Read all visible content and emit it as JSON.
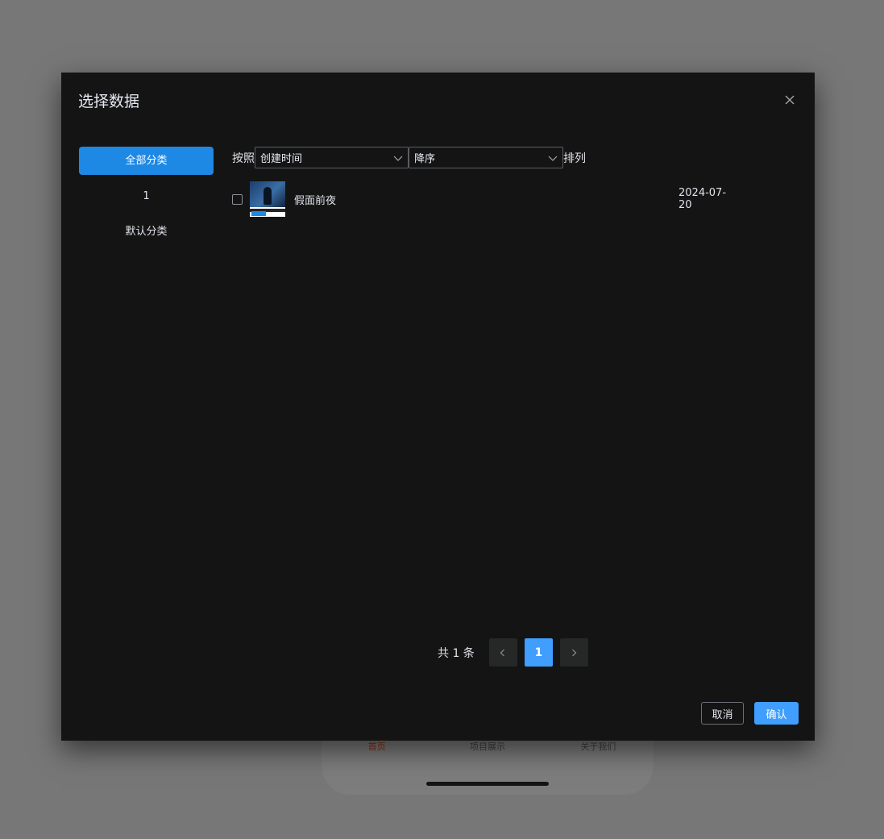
{
  "background_app": {
    "tabs": [
      {
        "label": "首页",
        "active": true
      },
      {
        "label": "项目展示",
        "active": false
      },
      {
        "label": "关于我们",
        "active": false
      }
    ]
  },
  "dialog": {
    "title": "选择数据",
    "close_icon": "close-icon"
  },
  "categories": [
    {
      "label": "全部分类",
      "active": true
    },
    {
      "label": "1",
      "active": false
    },
    {
      "label": "默认分类",
      "active": false
    }
  ],
  "sort": {
    "prefix": "按照",
    "field_value": "创建时间",
    "order_value": "降序",
    "suffix": "排列"
  },
  "items": [
    {
      "name": "假面前夜",
      "date": "2024-07-20",
      "checked": false
    }
  ],
  "pagination": {
    "total_label": "共 1 条",
    "current_page": "1",
    "prev_icon": "chevron-left-icon",
    "next_icon": "chevron-right-icon"
  },
  "footer": {
    "cancel_label": "取消",
    "confirm_label": "确认"
  },
  "colors": {
    "overlay": "#777777",
    "dialog_bg": "#141414",
    "primary": "#409eff",
    "category_active": "#1e88e5"
  }
}
